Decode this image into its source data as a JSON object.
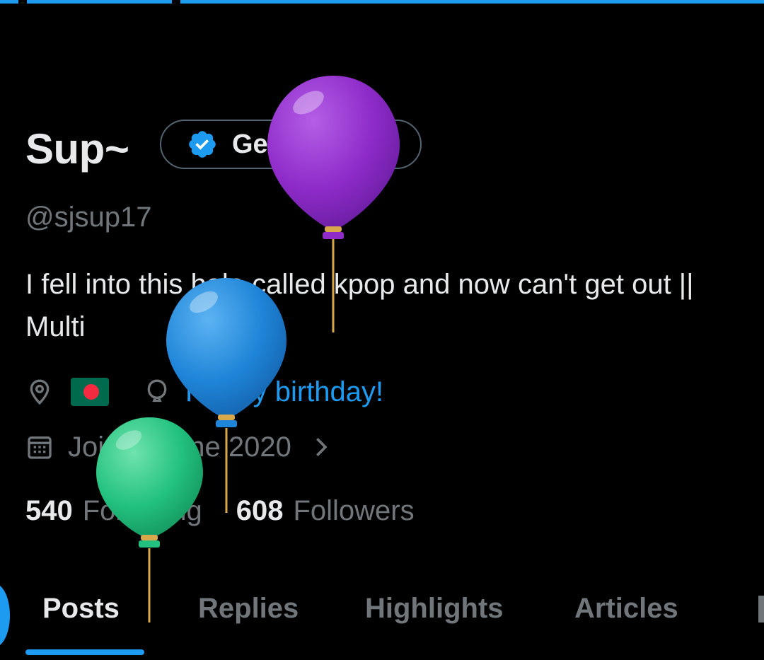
{
  "profile": {
    "name": "Sup~",
    "verify_button_label": "Get verified",
    "handle": "@sjsup17",
    "bio": "I fell into this hole called kpop and now can't get out || Multi",
    "birthday_text": "Happy birthday!",
    "joined": "Joined June 2020"
  },
  "stats": {
    "following_count": "540",
    "following_label": "Following",
    "followers_count": "608",
    "followers_label": "Followers"
  },
  "tabs": [
    {
      "label": "Posts",
      "active": true
    },
    {
      "label": "Replies",
      "active": false
    },
    {
      "label": "Highlights",
      "active": false
    },
    {
      "label": "Articles",
      "active": false
    }
  ],
  "icons": {
    "verify": "verified-badge-icon",
    "location": "location-pin-icon",
    "flag": "bangladesh-flag-icon",
    "birthday": "balloon-icon",
    "calendar": "calendar-icon",
    "chevron": "chevron-right-icon"
  },
  "colors": {
    "accent": "#1d9bf0",
    "background": "#000000",
    "text_primary": "#e7e9ea",
    "text_secondary": "#71767b",
    "balloon_purple": "#8e2bc9",
    "balloon_blue": "#1f85d8",
    "balloon_green": "#22c17f"
  }
}
